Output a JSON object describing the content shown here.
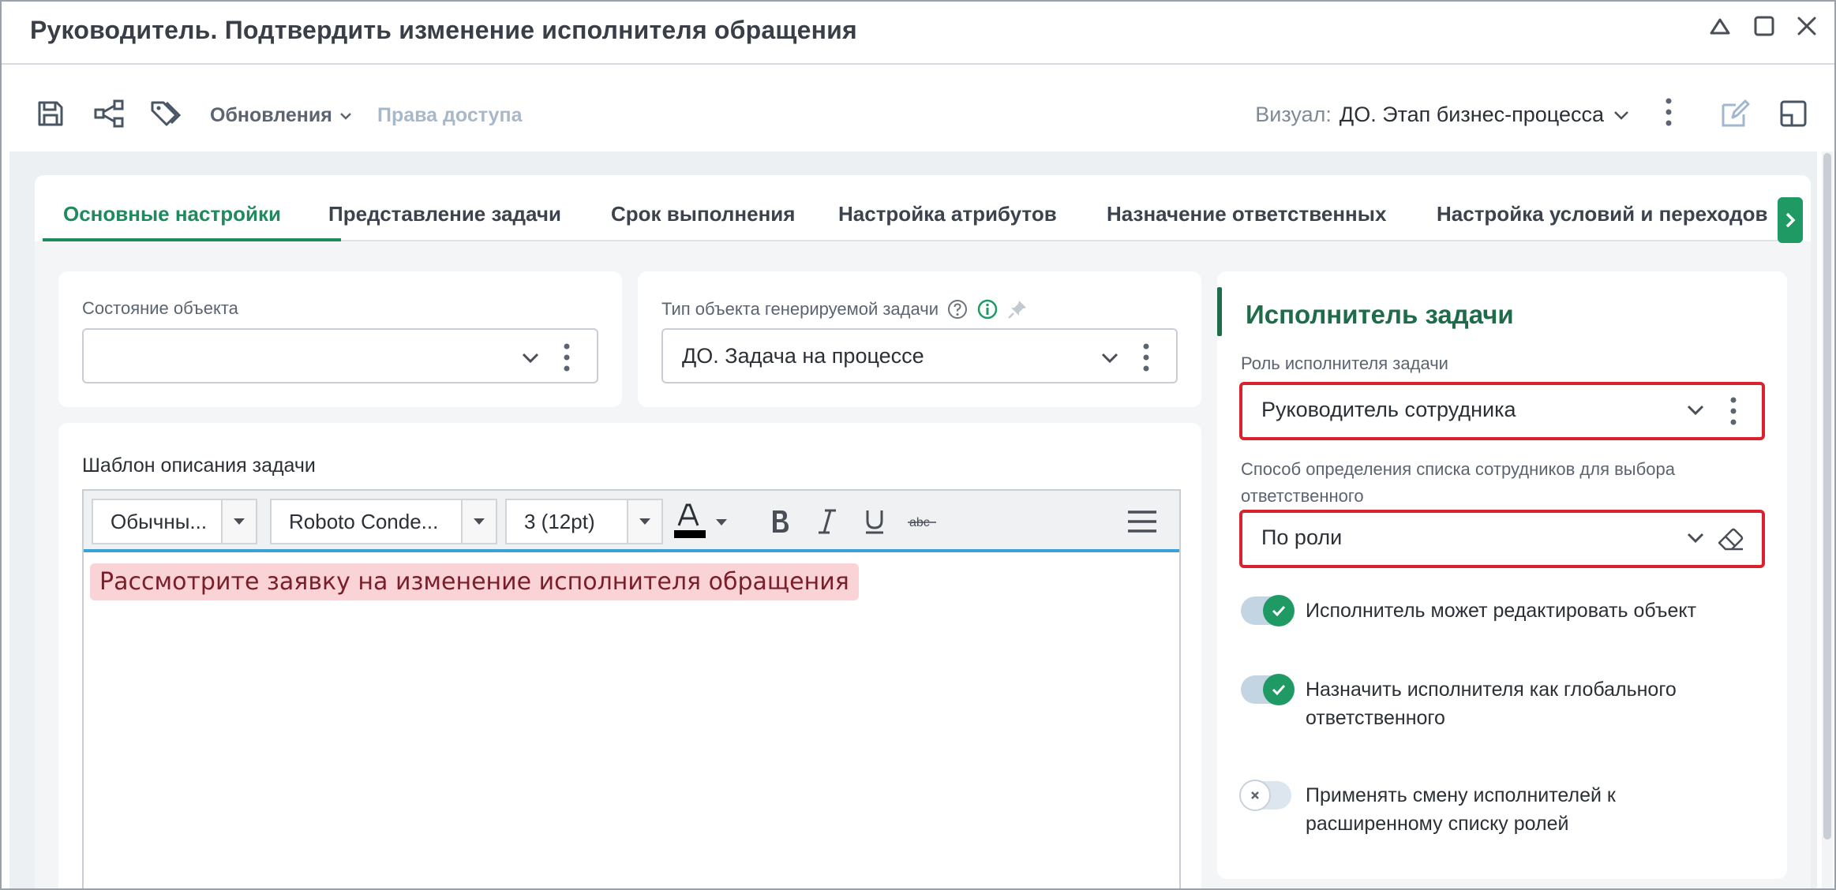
{
  "window": {
    "title": "Руководитель. Подтвердить изменение исполнителя обращения"
  },
  "toolbar": {
    "updates_label": "Обновления",
    "access_label": "Права доступа",
    "visual_label": "Визуал:",
    "visual_value": "ДО. Этап бизнес-процесса"
  },
  "tabs": [
    {
      "label": "Основные настройки",
      "active": true
    },
    {
      "label": "Представление задачи"
    },
    {
      "label": "Срок выполнения"
    },
    {
      "label": "Настройка атрибутов"
    },
    {
      "label": "Назначение ответственных"
    },
    {
      "label": "Настройка условий и переходов"
    }
  ],
  "object_state": {
    "label": "Состояние объекта",
    "value": ""
  },
  "task_type": {
    "label": "Тип объекта генерируемой задачи",
    "value": "ДО. Задача на процессе"
  },
  "editor": {
    "title": "Шаблон описания задачи",
    "style": "Обычны...",
    "font": "Roboto Conde...",
    "size": "3 (12pt)",
    "text": "Рассмотрите заявку на изменение исполнителя обращения"
  },
  "executor": {
    "title": "Исполнитель задачи",
    "role_label": "Роль исполнителя задачи",
    "role_value": "Руководитель сотрудника",
    "method_label": "Способ определения списка сотрудников для выбора ответственного",
    "method_value": "По роли",
    "toggles": [
      {
        "label": "Исполнитель может редактировать объект",
        "on": true
      },
      {
        "label": "Назначить исполнителя как глобального ответственного",
        "on": true
      },
      {
        "label": "Применять смену исполнителей к расширенному списку ролей",
        "on": false
      }
    ]
  },
  "colors": {
    "accent_green": "#1f8a5c",
    "highlight_red": "#d8232f",
    "editor_blue": "#3aa1d8"
  }
}
